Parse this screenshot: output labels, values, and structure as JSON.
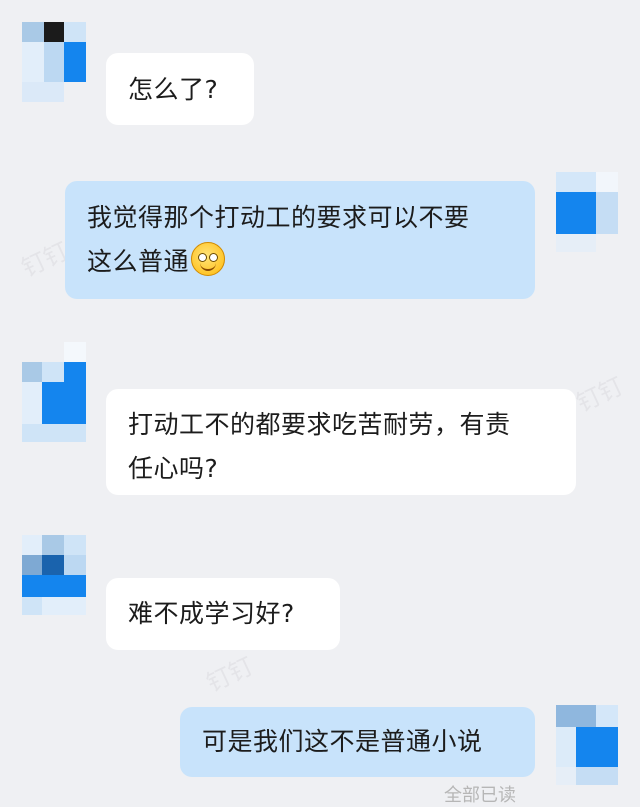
{
  "messages": [
    {
      "id": 1,
      "side": "incoming",
      "text": "怎么了?"
    },
    {
      "id": 2,
      "side": "outgoing",
      "lines": [
        "我觉得那个打动工的要求可以不要",
        "这么普通"
      ],
      "emoji": "smiling-face-emoji"
    },
    {
      "id": 3,
      "side": "incoming",
      "lines": [
        "打动工不的都要求吃苦耐劳，有责",
        "任心吗?"
      ]
    },
    {
      "id": 4,
      "side": "incoming",
      "text": "难不成学习好?"
    },
    {
      "id": 5,
      "side": "outgoing",
      "text": "可是我们这不是普通小说"
    }
  ],
  "read_status": "全部已读",
  "watermark_text": "钉钉",
  "colors": {
    "background": "#eff0f3",
    "incoming_bubble": "#ffffff",
    "outgoing_bubble": "#c8e3fb",
    "avatar_blue": "#1485ee"
  }
}
